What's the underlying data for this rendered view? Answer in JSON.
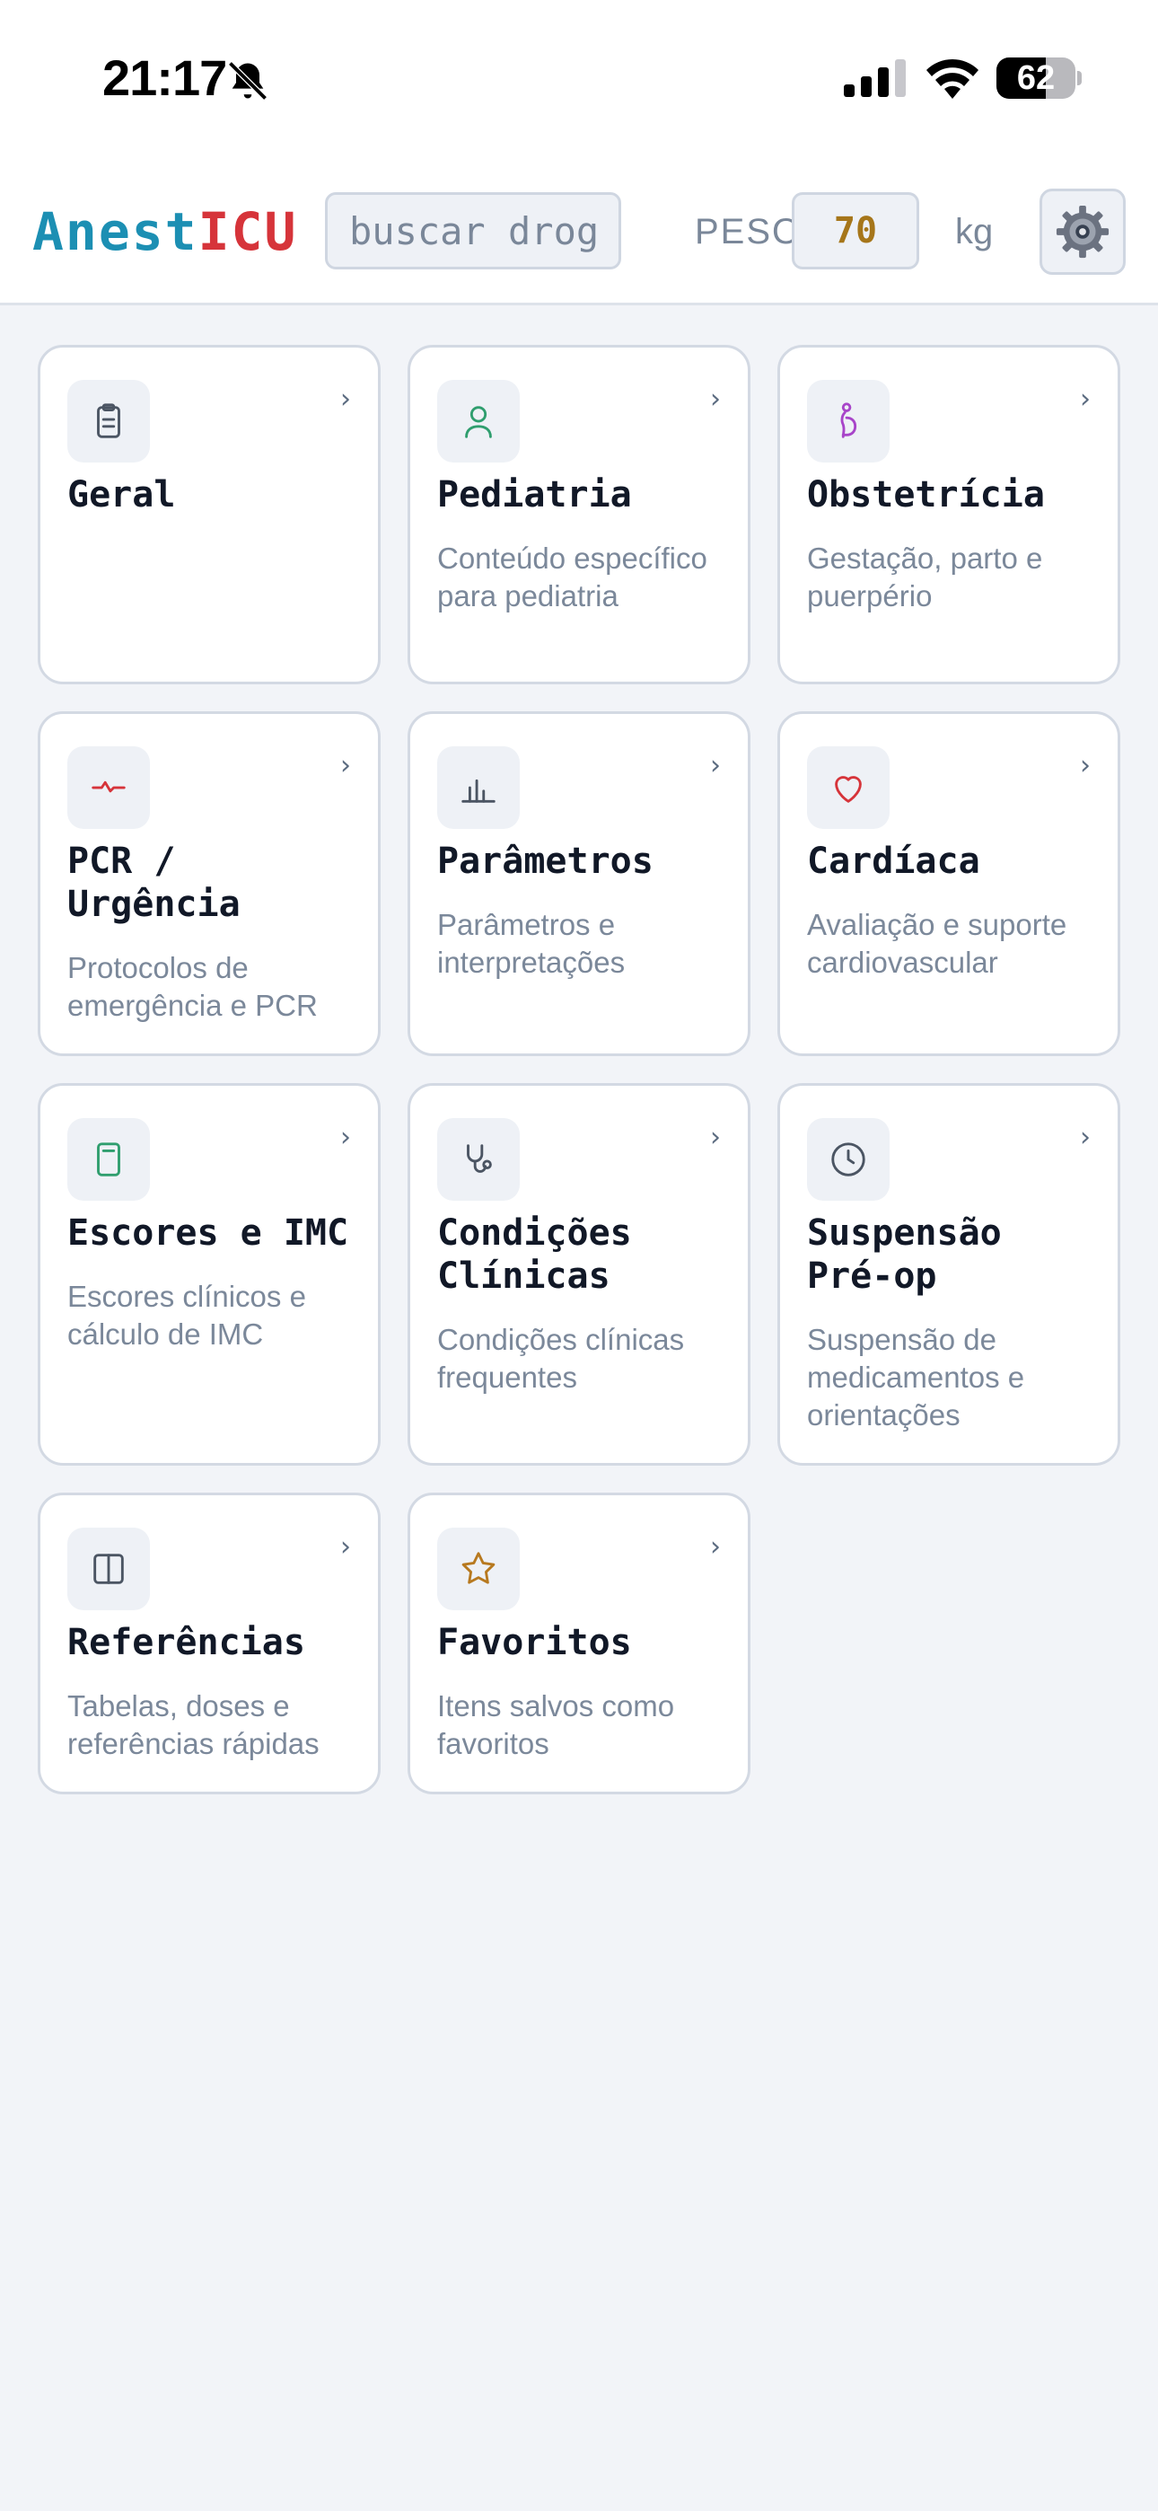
{
  "status_bar": {
    "time": "21:17",
    "battery_level": "62",
    "battery_fraction": 0.62
  },
  "header": {
    "logo_part1": "Anest",
    "logo_part2": "ICU",
    "search_placeholder": "buscar drog",
    "weight_label": "PESO",
    "weight_value": "70",
    "weight_unit": "kg"
  },
  "colors": {
    "logo_teal": "#1c8fb3",
    "logo_red": "#d6343a",
    "weight_value": "#a6761a",
    "card_border": "#d3d9e3",
    "background": "#f2f4f8"
  },
  "cards": [
    {
      "title": "Geral",
      "desc": "",
      "icon": "clipboard-icon",
      "icon_color": "#4b5563"
    },
    {
      "title": "Pediatria",
      "desc": "Conteúdo específico para pediatria",
      "icon": "person-icon",
      "icon_color": "#2f9e6e"
    },
    {
      "title": "Obstetrícia",
      "desc": "Gestação, parto e puerpério",
      "icon": "pregnant-icon",
      "icon_color": "#a845c9"
    },
    {
      "title": "PCR / Urgência",
      "desc": "Protocolos de emergência e PCR",
      "icon": "pulse-icon",
      "icon_color": "#d6343a"
    },
    {
      "title": "Parâmetros",
      "desc": "Parâmetros e interpretações",
      "icon": "bar-chart-icon",
      "icon_color": "#4b5563"
    },
    {
      "title": "Cardíaca",
      "desc": "Avaliação e suporte cardiovascular",
      "icon": "heart-icon",
      "icon_color": "#d6343a"
    },
    {
      "title": "Escores e IMC",
      "desc": "Escores clínicos e cálculo de IMC",
      "icon": "calculator-icon",
      "icon_color": "#2f9e6e"
    },
    {
      "title": "Condições Clínicas",
      "desc": "Condições clínicas frequentes",
      "icon": "stethoscope-icon",
      "icon_color": "#4b5563"
    },
    {
      "title": "Suspensão Pré-op",
      "desc": "Suspensão de medicamentos e orientações",
      "icon": "clock-icon",
      "icon_color": "#4b5563"
    },
    {
      "title": "Referências",
      "desc": "Tabelas, doses e referências rápidas",
      "icon": "book-icon",
      "icon_color": "#4b5563"
    },
    {
      "title": "Favoritos",
      "desc": "Itens salvos como favoritos",
      "icon": "star-icon",
      "icon_color": "#b7791f"
    }
  ]
}
